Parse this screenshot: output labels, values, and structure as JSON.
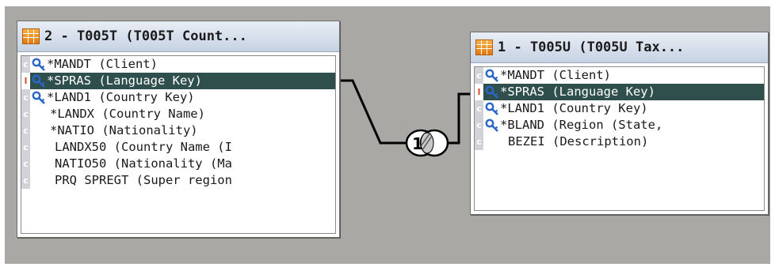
{
  "diagram": {
    "relationship": {
      "cardinality_label": "1",
      "icon": "relationship-join-icon"
    },
    "left_table": {
      "title": "2 - T005T (T005T Count...",
      "icon": "table-grid-icon",
      "fields": [
        {
          "kind": "c",
          "key": true,
          "text": "*MANDT (Client)"
        },
        {
          "kind": "l",
          "key": true,
          "text": "*SPRAS (Language Key)",
          "selected": true
        },
        {
          "kind": "c",
          "key": true,
          "text": "*LAND1 (Country Key)"
        },
        {
          "kind": "c",
          "key": false,
          "text": "*LANDX (Country Name)"
        },
        {
          "kind": "c",
          "key": false,
          "text": "*NATIO (Nationality)"
        },
        {
          "kind": "c",
          "key": false,
          "text": "LANDX50 (Country Name (I"
        },
        {
          "kind": "c",
          "key": false,
          "text": "NATIO50 (Nationality (Ma"
        },
        {
          "kind": "c",
          "key": false,
          "text": "PRQ SPREGT (Super region"
        }
      ]
    },
    "right_table": {
      "title": "1 - T005U (T005U Tax...",
      "icon": "table-grid-icon",
      "fields": [
        {
          "kind": "c",
          "key": true,
          "text": "*MANDT (Client)"
        },
        {
          "kind": "l",
          "key": true,
          "text": "*SPRAS (Language Key)",
          "selected": true
        },
        {
          "kind": "c",
          "key": true,
          "text": "*LAND1 (Country Key)"
        },
        {
          "kind": "c",
          "key": true,
          "text": "*BLAND (Region (State,"
        },
        {
          "kind": "c",
          "key": false,
          "text": "BEZEI (Description)"
        }
      ]
    },
    "colors": {
      "canvas": "#a9a8a5",
      "selected_row": "#2f4f4c",
      "header": "#c6d2e3",
      "key_icon": "#2a66c8"
    }
  }
}
